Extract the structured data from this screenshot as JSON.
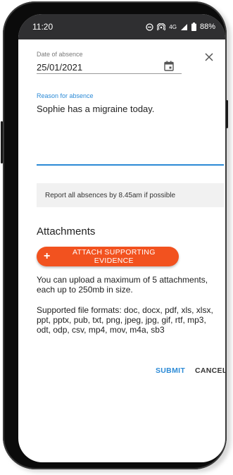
{
  "status_bar": {
    "time": "11:20",
    "network": "4G",
    "battery": "88%"
  },
  "form": {
    "date_label": "Date of absence",
    "date_value": "25/01/2021",
    "reason_label": "Reason for absence",
    "reason_value": "Sophie has a migraine today."
  },
  "info_text": "Report all absences by 8.45am if possible",
  "attachments": {
    "heading": "Attachments",
    "button_label": "ATTACH SUPPORTING EVIDENCE",
    "limit_text": "You can upload a maximum of 5 attachments, each up to 250mb in size.",
    "formats_text": "Supported file formats: doc, docx, pdf, xls, xlsx, ppt, pptx, pub, txt, png, jpeg, jpg, gif, rtf, mp3, odt, odp, csv, mp4, mov, m4a, sb3"
  },
  "actions": {
    "submit": "SUBMIT",
    "cancel": "CANCEL"
  },
  "colors": {
    "accent_blue": "#2b8ad6",
    "attach_orange": "#f2521f",
    "status_bar_bg": "#2f2f31"
  }
}
